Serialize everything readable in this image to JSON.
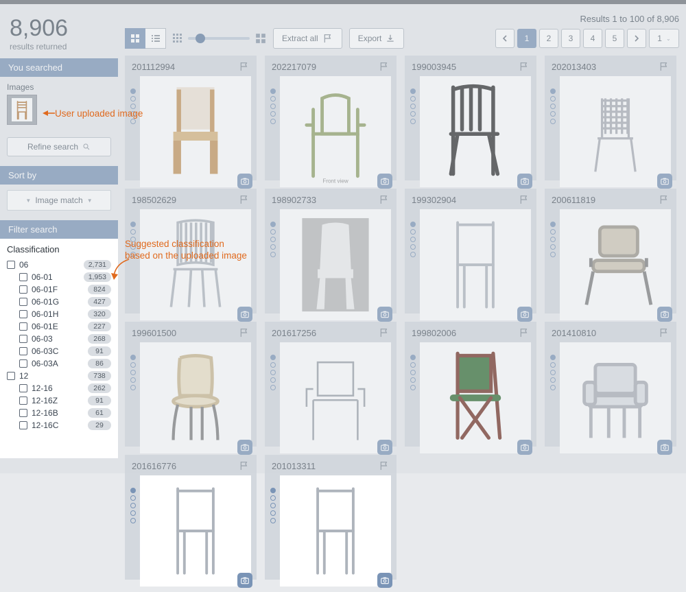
{
  "results": {
    "count": "8,906",
    "count_label": "results returned",
    "range_text": "Results 1 to 100 of 8,906"
  },
  "sidebar": {
    "you_searched": "You searched",
    "images_label": "Images",
    "refine": "Refine search",
    "sort_by": "Sort by",
    "sort_value": "Image match",
    "filter_search": "Filter search"
  },
  "facets": {
    "title": "Classification",
    "items": [
      {
        "label": "06",
        "count": "2,731",
        "level": 0
      },
      {
        "label": "06-01",
        "count": "1,953",
        "level": 1
      },
      {
        "label": "06-01F",
        "count": "824",
        "level": 1
      },
      {
        "label": "06-01G",
        "count": "427",
        "level": 1
      },
      {
        "label": "06-01H",
        "count": "320",
        "level": 1
      },
      {
        "label": "06-01E",
        "count": "227",
        "level": 1
      },
      {
        "label": "06-03",
        "count": "268",
        "level": 1
      },
      {
        "label": "06-03C",
        "count": "91",
        "level": 1
      },
      {
        "label": "06-03A",
        "count": "86",
        "level": 1
      },
      {
        "label": "12",
        "count": "738",
        "level": 0
      },
      {
        "label": "12-16",
        "count": "262",
        "level": 1
      },
      {
        "label": "12-16Z",
        "count": "91",
        "level": 1
      },
      {
        "label": "12-16B",
        "count": "61",
        "level": 1
      },
      {
        "label": "12-16C",
        "count": "29",
        "level": 1
      }
    ]
  },
  "toolbar": {
    "extract_all": "Extract all",
    "export": "Export"
  },
  "pager": {
    "pages": [
      "1",
      "2",
      "3",
      "4",
      "5"
    ],
    "active": "1",
    "jump": "1"
  },
  "cards": [
    {
      "id": "201112994",
      "variant": "wood"
    },
    {
      "id": "202217079",
      "variant": "armline",
      "caption": "Front view"
    },
    {
      "id": "199003945",
      "variant": "slat"
    },
    {
      "id": "202013403",
      "variant": "mesh"
    },
    {
      "id": "198502629",
      "variant": "stack"
    },
    {
      "id": "198902733",
      "variant": "plastic"
    },
    {
      "id": "199302904",
      "variant": "simple"
    },
    {
      "id": "200611819",
      "variant": "office"
    },
    {
      "id": "199601500",
      "variant": "curved"
    },
    {
      "id": "201617256",
      "variant": "sketch"
    },
    {
      "id": "199802006",
      "variant": "folding"
    },
    {
      "id": "201410810",
      "variant": "armchair"
    },
    {
      "id": "201616776",
      "variant": "simple"
    },
    {
      "id": "201013311",
      "variant": "simple"
    }
  ],
  "annotations": {
    "upload": "User uploaded image",
    "suggest_l1": "Suggested classification",
    "suggest_l2": "based on the uploaded image"
  }
}
